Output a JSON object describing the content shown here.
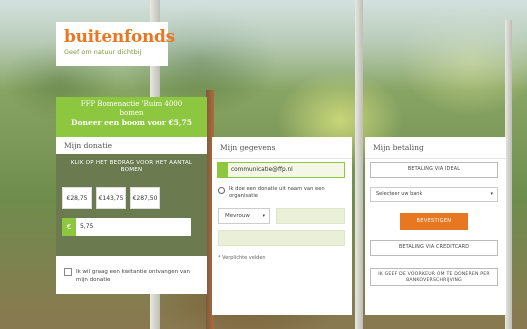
{
  "logo": {
    "brand_left": "buiten",
    "brand_right": "fonds",
    "slogan": "Geef om natuur dichtbij"
  },
  "donation": {
    "banner_line1": "FFP Bomenactie 'Ruim 4000",
    "banner_line2": "bomen",
    "banner_line3": "Doneer een boom voor €5,75",
    "section_title": "Mijn donatie",
    "instruction": "KLIK OP HET BEDRAG VOOR HET AANTAL BOMEN",
    "amounts": [
      "€28,75",
      "€143,75",
      "€287,50"
    ],
    "currency_symbol": "€",
    "custom_amount": "5,75",
    "checkbox_label": "Ik wil graag een kwitantie ontvangen van mijn donatie"
  },
  "gegevens": {
    "section_title": "Mijn gegevens",
    "email_value": "communicatie@ffp.nl",
    "radio_label": "Ik doe een donatie uit naam van een organisatie",
    "salutation_selected": "Mevrouw",
    "required_note": "* Verplichte velden"
  },
  "betaling": {
    "section_title": "Mijn betaling",
    "ideal_button": "BETALING VIA IDEAL",
    "bank_select_placeholder": "Selecteer uw bank",
    "submit_button": "BEVESTIGEN",
    "creditcard_button": "BETALING VIA CREDITCARD",
    "mandate_button": "IK GEEF DE VOORKEUR OM TE DONEREN PER BANKOVERSCHRIJVING"
  },
  "colors": {
    "accent_green": "#8dc63f",
    "accent_orange": "#e87722",
    "panel_dark": "#6b7a4f"
  }
}
